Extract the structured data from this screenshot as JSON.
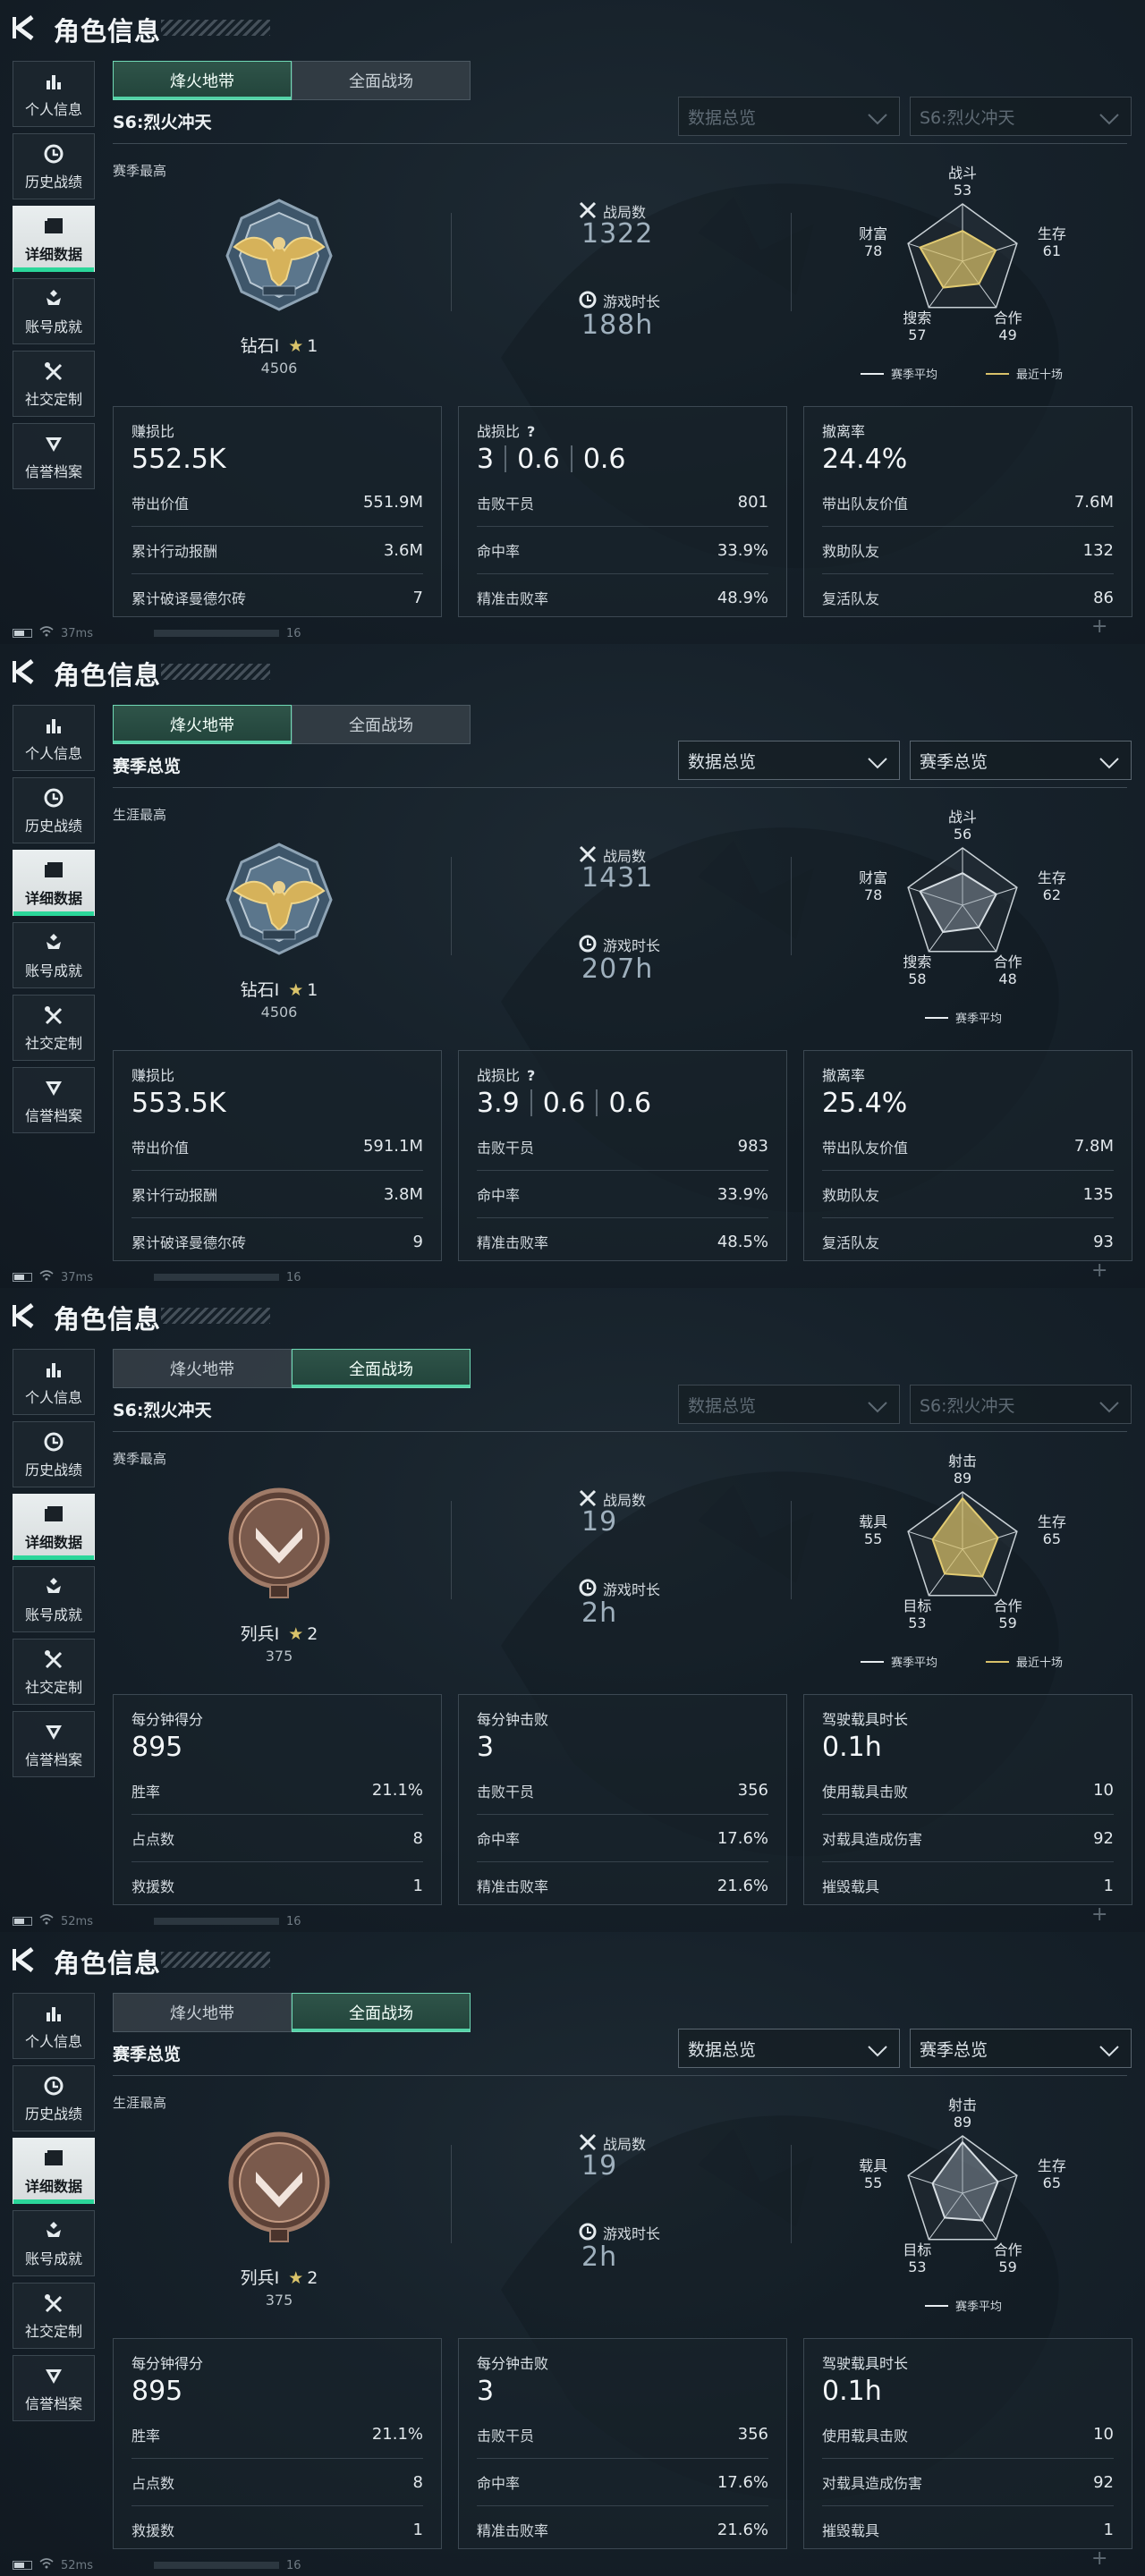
{
  "colors": {
    "accent": "#2bd69a",
    "radar_avg": "#e8edf1",
    "radar_recent": "#d8c16a"
  },
  "panels": [
    {
      "title": "角色信息",
      "sidebar": [
        "个人信息",
        "历史战绩",
        "详细数据",
        "账号成就",
        "社交定制",
        "信誉档案"
      ],
      "sidebar_active": 2,
      "mode_tabs": [
        "烽火地带",
        "全面战场"
      ],
      "mode_active": 0,
      "season": "S6:烈火冲天",
      "dropdowns": [
        "数据总览",
        "S6:烈火冲天"
      ],
      "dropdowns_dim": true,
      "best_label": "赛季最高",
      "emblem": "diamond-eagle",
      "rank_name": "钻石Ⅰ",
      "rank_star": "1",
      "rank_points": "4506",
      "matches_label": "战局数",
      "matches": "1322",
      "time_label": "游戏时长",
      "time": "188h",
      "radar": {
        "axes": [
          "战斗",
          "生存",
          "合作",
          "搜索",
          "财富"
        ],
        "values": [
          53,
          61,
          49,
          57,
          78
        ],
        "shape": "gold",
        "legend": [
          "赛季平均",
          "最近十场"
        ]
      },
      "cards": [
        {
          "title": "赚损比",
          "value": [
            "552.5K"
          ],
          "rows": [
            [
              "带出价值",
              "551.9M"
            ],
            [
              "累计行动报酬",
              "3.6M"
            ],
            [
              "累计破译曼德尔砖",
              "7"
            ]
          ]
        },
        {
          "title": "战损比",
          "value": [
            "3",
            "0.6",
            "0.6"
          ],
          "q": "?",
          "rows": [
            [
              "击败干员",
              "801"
            ],
            [
              "命中率",
              "33.9%"
            ],
            [
              "精准击败率",
              "48.9%"
            ]
          ]
        },
        {
          "title": "撤离率",
          "value": [
            "24.4%"
          ],
          "rows": [
            [
              "带出队友价值",
              "7.6M"
            ],
            [
              "救助队友",
              "132"
            ],
            [
              "复活队友",
              "86"
            ]
          ]
        }
      ],
      "status": {
        "ping": "37ms",
        "num": "16"
      }
    },
    {
      "title": "角色信息",
      "sidebar": [
        "个人信息",
        "历史战绩",
        "详细数据",
        "账号成就",
        "社交定制",
        "信誉档案"
      ],
      "sidebar_active": 2,
      "mode_tabs": [
        "烽火地带",
        "全面战场"
      ],
      "mode_active": 0,
      "season": "赛季总览",
      "dropdowns": [
        "数据总览",
        "赛季总览"
      ],
      "dropdowns_dim": false,
      "best_label": "生涯最高",
      "emblem": "diamond-eagle",
      "rank_name": "钻石Ⅰ",
      "rank_star": "1",
      "rank_points": "4506",
      "matches_label": "战局数",
      "matches": "1431",
      "time_label": "游戏时长",
      "time": "207h",
      "radar": {
        "axes": [
          "战斗",
          "生存",
          "合作",
          "搜索",
          "财富"
        ],
        "values": [
          56,
          62,
          48,
          58,
          78
        ],
        "shape": "grey",
        "legend": [
          "赛季平均"
        ]
      },
      "cards": [
        {
          "title": "赚损比",
          "value": [
            "553.5K"
          ],
          "rows": [
            [
              "带出价值",
              "591.1M"
            ],
            [
              "累计行动报酬",
              "3.8M"
            ],
            [
              "累计破译曼德尔砖",
              "9"
            ]
          ]
        },
        {
          "title": "战损比",
          "value": [
            "3.9",
            "0.6",
            "0.6"
          ],
          "q": "?",
          "rows": [
            [
              "击败干员",
              "983"
            ],
            [
              "命中率",
              "33.9%"
            ],
            [
              "精准击败率",
              "48.5%"
            ]
          ]
        },
        {
          "title": "撤离率",
          "value": [
            "25.4%"
          ],
          "rows": [
            [
              "带出队友价值",
              "7.8M"
            ],
            [
              "救助队友",
              "135"
            ],
            [
              "复活队友",
              "93"
            ]
          ]
        }
      ],
      "status": {
        "ping": "37ms",
        "num": "16"
      }
    },
    {
      "title": "角色信息",
      "sidebar": [
        "个人信息",
        "历史战绩",
        "详细数据",
        "账号成就",
        "社交定制",
        "信誉档案"
      ],
      "sidebar_active": 2,
      "mode_tabs": [
        "烽火地带",
        "全面战场"
      ],
      "mode_active": 1,
      "season": "S6:烈火冲天",
      "dropdowns": [
        "数据总览",
        "S6:烈火冲天"
      ],
      "dropdowns_dim": true,
      "best_label": "赛季最高",
      "emblem": "private-chevron",
      "rank_name": "列兵Ⅰ",
      "rank_star": "2",
      "rank_points": "375",
      "matches_label": "战局数",
      "matches": "19",
      "time_label": "游戏时长",
      "time": "2h",
      "radar": {
        "axes": [
          "射击",
          "生存",
          "合作",
          "目标",
          "载具"
        ],
        "values": [
          89,
          65,
          59,
          53,
          55
        ],
        "shape": "gold",
        "legend": [
          "赛季平均",
          "最近十场"
        ]
      },
      "cards": [
        {
          "title": "每分钟得分",
          "value": [
            "895"
          ],
          "rows": [
            [
              "胜率",
              "21.1%"
            ],
            [
              "占点数",
              "8"
            ],
            [
              "救援数",
              "1"
            ]
          ]
        },
        {
          "title": "每分钟击败",
          "value": [
            "3"
          ],
          "rows": [
            [
              "击败干员",
              "356"
            ],
            [
              "命中率",
              "17.6%"
            ],
            [
              "精准击败率",
              "21.6%"
            ]
          ]
        },
        {
          "title": "驾驶载具时长",
          "value": [
            "0.1h"
          ],
          "rows": [
            [
              "使用载具击败",
              "10"
            ],
            [
              "对载具造成伤害",
              "92"
            ],
            [
              "摧毁载具",
              "1"
            ]
          ]
        }
      ],
      "status": {
        "ping": "52ms",
        "num": "16"
      }
    },
    {
      "title": "角色信息",
      "sidebar": [
        "个人信息",
        "历史战绩",
        "详细数据",
        "账号成就",
        "社交定制",
        "信誉档案"
      ],
      "sidebar_active": 2,
      "mode_tabs": [
        "烽火地带",
        "全面战场"
      ],
      "mode_active": 1,
      "season": "赛季总览",
      "dropdowns": [
        "数据总览",
        "赛季总览"
      ],
      "dropdowns_dim": false,
      "best_label": "生涯最高",
      "emblem": "private-chevron",
      "rank_name": "列兵Ⅰ",
      "rank_star": "2",
      "rank_points": "375",
      "matches_label": "战局数",
      "matches": "19",
      "time_label": "游戏时长",
      "time": "2h",
      "radar": {
        "axes": [
          "射击",
          "生存",
          "合作",
          "目标",
          "载具"
        ],
        "values": [
          89,
          65,
          59,
          53,
          55
        ],
        "shape": "grey",
        "legend": [
          "赛季平均"
        ]
      },
      "cards": [
        {
          "title": "每分钟得分",
          "value": [
            "895"
          ],
          "rows": [
            [
              "胜率",
              "21.1%"
            ],
            [
              "占点数",
              "8"
            ],
            [
              "救援数",
              "1"
            ]
          ]
        },
        {
          "title": "每分钟击败",
          "value": [
            "3"
          ],
          "rows": [
            [
              "击败干员",
              "356"
            ],
            [
              "命中率",
              "17.6%"
            ],
            [
              "精准击败率",
              "21.6%"
            ]
          ]
        },
        {
          "title": "驾驶载具时长",
          "value": [
            "0.1h"
          ],
          "rows": [
            [
              "使用载具击败",
              "10"
            ],
            [
              "对载具造成伤害",
              "92"
            ],
            [
              "摧毁载具",
              "1"
            ]
          ]
        }
      ],
      "status": {
        "ping": "52ms",
        "num": "16"
      }
    }
  ]
}
